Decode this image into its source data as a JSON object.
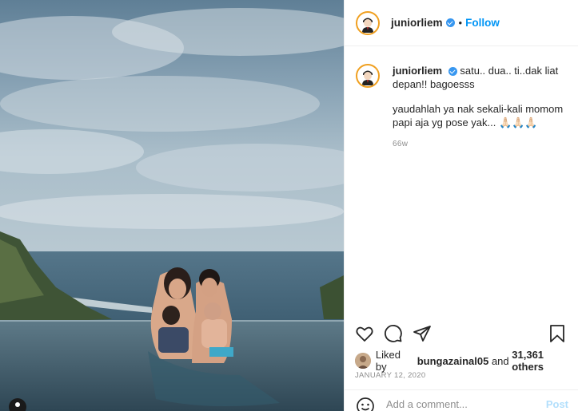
{
  "post": {
    "username": "juniorliem",
    "follow_label": "Follow",
    "separator": "•"
  },
  "caption": {
    "username": "juniorliem",
    "text1": "satu.. dua.. ti..dak liat depan!! bagoesss",
    "text2": "yaudahlah ya nak sekali-kali momom papi aja yg pose yak... 🙏🏻🙏🏻🙏🏻",
    "time_ago": "66w"
  },
  "likes": {
    "prefix": "Liked by",
    "user": "bungazainal05",
    "joiner": "and",
    "others": "31,361 others"
  },
  "date": "JANUARY 12, 2020",
  "comment_box": {
    "placeholder": "Add a comment...",
    "post_label": "Post"
  },
  "icons": {
    "like": "heart-icon",
    "comment": "comment-icon",
    "share": "share-icon",
    "save": "bookmark-icon",
    "emoji": "emoji-icon",
    "tag": "user-tag-icon",
    "verified": "verified-badge-icon"
  },
  "colors": {
    "follow": "#0095f6",
    "verified": "#3897f0",
    "avatar_ring": "#f0a020",
    "muted": "#8e8e8e",
    "post_disabled": "#b2dffc"
  }
}
